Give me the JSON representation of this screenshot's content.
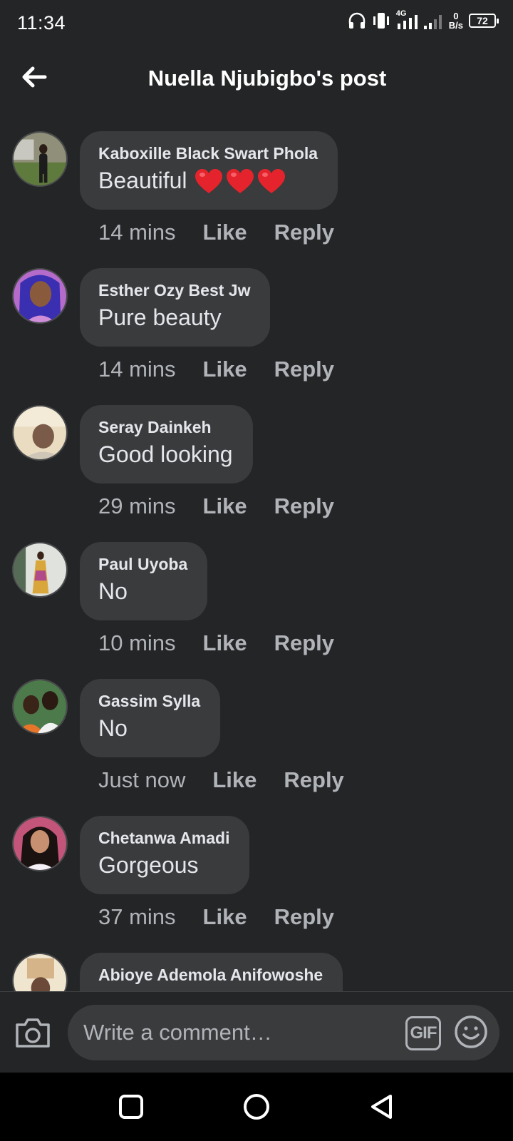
{
  "status_bar": {
    "time": "11:34",
    "network": "4G",
    "speed_value": "0",
    "speed_unit": "B/s",
    "battery": "72"
  },
  "header": {
    "title": "Nuella Njubigbo's post",
    "back_icon": "arrow-left-icon"
  },
  "comments": [
    {
      "author": "Kaboxille Black Swart Phola",
      "text": "Beautiful",
      "emoji": "heart",
      "emoji_count": 3,
      "time": "14 mins",
      "like": "Like",
      "reply": "Reply"
    },
    {
      "author": "Esther Ozy Best Jw",
      "text": "Pure beauty",
      "time": "14 mins",
      "like": "Like",
      "reply": "Reply"
    },
    {
      "author": "Seray Dainkeh",
      "text": "Good looking",
      "time": "29 mins",
      "like": "Like",
      "reply": "Reply"
    },
    {
      "author": "Paul Uyoba",
      "text": "No",
      "time": "10 mins",
      "like": "Like",
      "reply": "Reply"
    },
    {
      "author": "Gassim Sylla",
      "text": "No",
      "time": "Just now",
      "like": "Like",
      "reply": "Reply"
    },
    {
      "author": "Chetanwa Amadi",
      "text": "Gorgeous",
      "time": "37 mins",
      "like": "Like",
      "reply": "Reply"
    },
    {
      "author": "Abioye Ademola Anifowoshe",
      "text": "",
      "time": "",
      "like": "",
      "reply": ""
    }
  ],
  "composer": {
    "placeholder": "Write a comment…",
    "gif_label": "GIF",
    "camera_icon": "camera-icon",
    "emoji_icon": "smiley-icon"
  },
  "nav": {
    "square_icon": "recents-square-icon",
    "circle_icon": "home-circle-icon",
    "back_icon": "back-triangle-icon"
  },
  "colors": {
    "background": "#242526",
    "bubble": "#3a3b3c",
    "primary_text": "#e4e6eb",
    "secondary_text": "#b0b3b8",
    "heart": "#e5232c"
  }
}
